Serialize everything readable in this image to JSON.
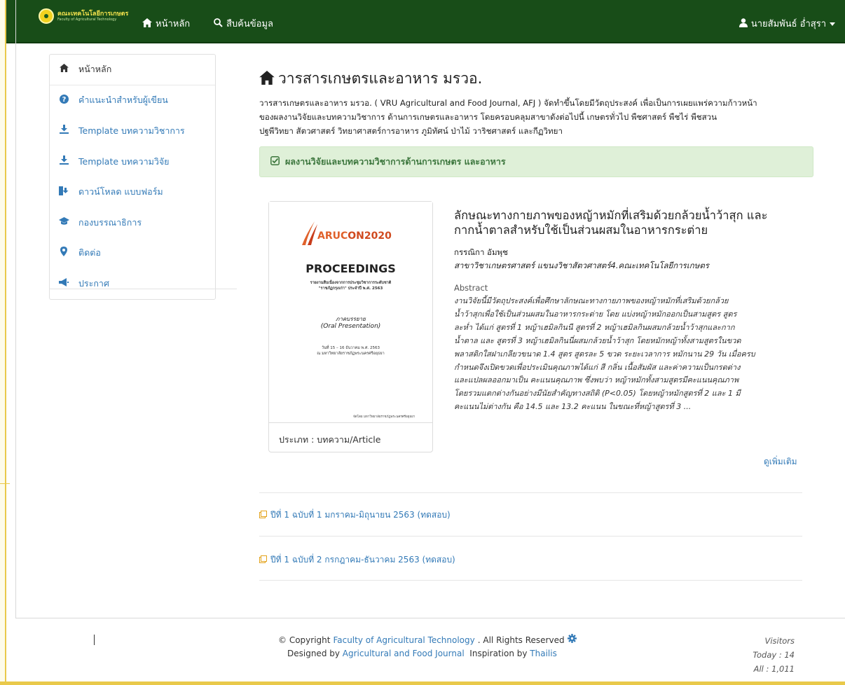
{
  "navbar": {
    "brand_line1": "คณะเทคโนโลยีการเกษตร",
    "brand_line2": "Faculty of Agricultural Technology",
    "home_label": "หน้าหลัก",
    "search_label": "สืบค้นข้อมูล",
    "user_label": "นายสัมพันธ์ อ่ำสุรา"
  },
  "sidebar": {
    "items": [
      {
        "label": "หน้าหลัก",
        "icon": "home-icon"
      },
      {
        "label": "คำแนะนำสำหรับผู้เขียน",
        "icon": "question-circle-icon"
      },
      {
        "label": "Template บทความวิชาการ",
        "icon": "download-icon"
      },
      {
        "label": "Template บทความวิจัย",
        "icon": "download-icon"
      },
      {
        "label": "ดาวน์โหลด แบบฟอร์ม",
        "icon": "download-forms-icon"
      },
      {
        "label": "กองบรรณาธิการ",
        "icon": "graduation-cap-icon"
      },
      {
        "label": "ติดต่อ",
        "icon": "map-marker-icon"
      },
      {
        "label": "ประกาศ",
        "icon": "megaphone-icon"
      }
    ]
  },
  "main": {
    "title": "วารสารเกษตรและอาหาร มรวอ.",
    "intro_lines": [
      "วารสารเกษตรและอาหาร มรวอ. ( VRU Agricultural and Food Journal, AFJ ) จัดทำขึ้นโดยมีวัตถุประสงค์ เพื่อเป็นการเผยแพร่ความก้าวหน้า",
      "ของผลงานวิจัยและบทความวิชาการ ด้านการเกษตรและอาหาร โดยครอบคลุมสาขาดังต่อไปนี้ เกษตรทั่วไป พืชศาสตร์ พืชไร่ พืชสวน",
      "ปฐพีวิทยา สัตวศาสตร์ วิทยาศาสตร์การอาหาร ภูมิทัศน์ ป่าไม้ วาริชศาสตร์ และกีฏวิทยา"
    ],
    "alert_label": "ผลงานวิจัยและบทความวิชาการด้านการเกษตร และอาหาร"
  },
  "article": {
    "cover": {
      "logo_text_1": "ARUC",
      "logo_text_2": "ON2020",
      "proceedings": "PROCEEDINGS",
      "line1": "รายงานสืบเนื่องจากการประชุมวิชาการระดับชาติ",
      "line2": "\"ราชภัฏกรุงเก่า\" ประจำปี พ.ศ. 2563",
      "oral_th": "ภาคบรรยาย",
      "oral_en": "(Oral Presentation)",
      "date_line": "วันที่ 15 – 16 ธันวาคม พ.ศ. 2563",
      "venue_line": "ณ มหาวิทยาลัยราชภัฏพระนครศรีอยุธยา",
      "publisher": "จัดโดย มหาวิทยาลัยราชภัฏพระนครศรีอยุธยา"
    },
    "type_label": "ประเภท : บทความ/Article",
    "title_lines": [
      "ลักษณะทางกายภาพของหญ้าหมักที่เสริมด้วยกล้วยน้ำว้าสุก และ",
      "กากน้ำตาลสำหรับใช้เป็นส่วนผสมในอาหารกระต่าย"
    ],
    "author": "กรรณิกา อัมพุช",
    "affiliation": "สาขาวิชาเกษตรศาสตร์ แขนงวิชาสัตวศาสตร์4.คณะเทคโนโลยีการเกษตร",
    "abstract_label": "Abstract",
    "abstract_lines": [
      "งานวิจัยนี้มีวัตถุประสงค์เพื่อศึกษาลักษณะทางกายภาพของหญ้าหมักที่เสริมด้วยกล้วย",
      "น้ำว้าสุกเพื่อใช้เป็นส่วนผสมในอาหารกระต่าย โดย แบ่งหญ้าหมักออกเป็นสามสูตร สูตร",
      "ละห่ำ ได้แก่ สูตรที่ 1 หญ้าเฮมิลกินนี สูตรที่ 2 หญ้าเฮมิลกินผสมกล้วยน้ำว้าสุกและกาก",
      "น้ำตาล และ สูตรที่ 3 หญ้าเฮมิลกินนี่ผสมกล้วยน้ำว้าสุก โดยหมักหญ้าทั้งสามสูตรในขวด",
      "พลาสติกใสฝาเกลียวขนาด 1.4 สูตร สูตรละ 5 ขวด ระยะเวลาการ หมักนาน 29 วัน เมื่อครบ",
      "กำหนดจึงเปิดขวดเพื่อประเมินคุณภาพได้แก่ สี กลิ่น เนื้อสัมผัส และค่าความเป็นกรดด่าง",
      "และแปลผลออกมาเป็น คะแนนคุณภาพ ซึ่งพบว่า หญ้าหมักทั้งสามสูตรมีคะแนนคุณภาพ",
      "โดยรวมแตกต่างกันอย่างมีนัยสำคัญทางสถิติ (P<0.05) โดยหญ้าหมักสูตรที่ 2 และ 1 มี",
      "คะแนนไม่ต่างกัน คือ 14.5 และ 13.2 คะแนน ในขณะที่หญ้าสูตรที่ 3 ..."
    ],
    "more_label": "ดูเพิ่มเติม"
  },
  "issues": [
    "ปีที่ 1 ฉบับที่ 1 มกราคม-มิถุนายน 2563 (ทดสอบ)",
    "ปีที่ 1 ฉบับที่ 2 กรกฎาคม-ธันวาคม 2563 (ทดสอบ)"
  ],
  "footer": {
    "copy_prefix": "© Copyright",
    "copy_link": "Faculty of Agricultural Technology",
    "copy_suffix": ". All Rights Reserved",
    "designed_prefix": "Designed by",
    "designed_link": "Agricultural and Food Journal",
    "inspiration_prefix": "Inspiration by",
    "inspiration_link": "Thailis",
    "visitors_label": "Visitors",
    "today": "Today : 14",
    "all": "All : 1,011"
  },
  "colors": {
    "navbar_bg": "#184d18",
    "link": "#337ab7",
    "alert_bg": "#dff0d8",
    "alert_text": "#3c763d",
    "accent_edge": "#e9c94a"
  }
}
